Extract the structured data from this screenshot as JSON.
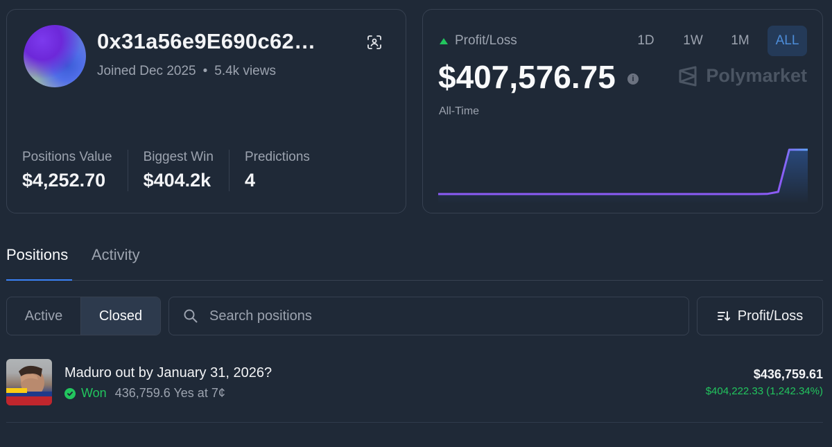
{
  "profile": {
    "address": "0x31a56e9E690c62…",
    "joined": "Joined Dec 2025",
    "separator": "•",
    "views": "5.4k views",
    "stats": [
      {
        "label": "Positions Value",
        "value": "$4,252.70"
      },
      {
        "label": "Biggest Win",
        "value": "$404.2k"
      },
      {
        "label": "Predictions",
        "value": "4"
      }
    ]
  },
  "pnl": {
    "title": "Profit/Loss",
    "amount": "$407,576.75",
    "info_icon": "i",
    "period": "All-Time",
    "ranges": [
      "1D",
      "1W",
      "1M",
      "ALL"
    ],
    "selected_range": "ALL",
    "brand": "Polymarket"
  },
  "chart_data": {
    "type": "area",
    "x": [
      0,
      10,
      20,
      30,
      40,
      50,
      60,
      70,
      80,
      86,
      89,
      92,
      95,
      100
    ],
    "values": [
      0,
      0,
      0,
      0,
      0,
      0,
      0,
      0,
      0,
      0,
      1000,
      20000,
      407576.75,
      407576.75
    ],
    "line_color": "#8b5cf6",
    "end_color": "#60a5fa",
    "grid": false,
    "axes": false
  },
  "tabs": [
    "Positions",
    "Activity"
  ],
  "active_tab": "Positions",
  "filters": {
    "status": [
      "Active",
      "Closed"
    ],
    "selected_status": "Closed",
    "search_placeholder": "Search positions",
    "sort_label": "Profit/Loss"
  },
  "positions": [
    {
      "title": "Maduro out by January 31, 2026?",
      "result": "Won",
      "detail": "436,759.6 Yes at 7¢",
      "value": "$436,759.61",
      "pnl": "$404,222.33 (1,242.34%)"
    }
  ],
  "colors": {
    "background": "#1f2937",
    "accent": "#3b82f6",
    "positive": "#22c55e"
  }
}
